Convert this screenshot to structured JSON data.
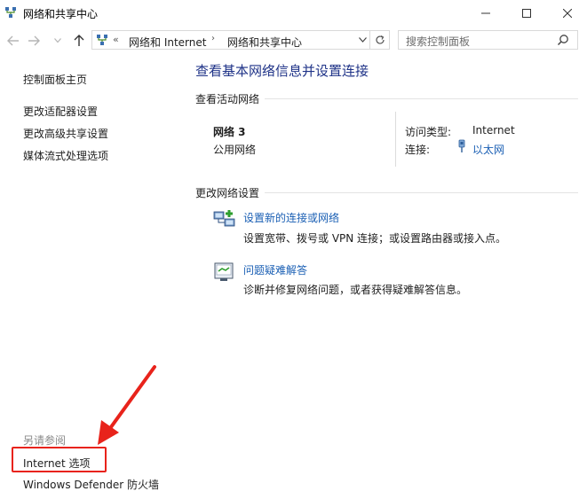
{
  "window": {
    "title": "网络和共享中心",
    "controls": {
      "minimize_icon": "minimize-icon",
      "maximize_icon": "maximize-icon",
      "close_icon": "close-icon"
    }
  },
  "addressbar": {
    "overflow": "«",
    "crumbs": [
      "网络和 Internet",
      "网络和共享中心"
    ],
    "separator": "›"
  },
  "search": {
    "placeholder": "搜索控制面板"
  },
  "left_pane": {
    "links": [
      "控制面板主页",
      "更改适配器设置",
      "更改高级共享设置",
      "媒体流式处理选项"
    ],
    "see_also_title": "另请参阅",
    "see_also_links": [
      "Internet 选项",
      "Windows Defender 防火墙"
    ]
  },
  "main": {
    "title": "查看基本网络信息并设置连接",
    "active_networks": {
      "heading": "查看活动网络",
      "network_name": "网络 3",
      "network_type": "公用网络",
      "access_type_label": "访问类型:",
      "access_type_value": "Internet",
      "connections_label": "连接:",
      "connections_value": "以太网"
    },
    "change_settings": {
      "heading": "更改网络设置",
      "tasks": [
        {
          "link": "设置新的连接或网络",
          "desc": "设置宽带、拨号或 VPN 连接；或设置路由器或接入点。",
          "icon": "new-connection-icon"
        },
        {
          "link": "问题疑难解答",
          "desc": "诊断并修复网络问题，或者获得疑难解答信息。",
          "icon": "troubleshoot-icon"
        }
      ]
    }
  },
  "colors": {
    "link": "#1a5fb4",
    "title": "#1e3287",
    "annotation": "#e8231b"
  }
}
